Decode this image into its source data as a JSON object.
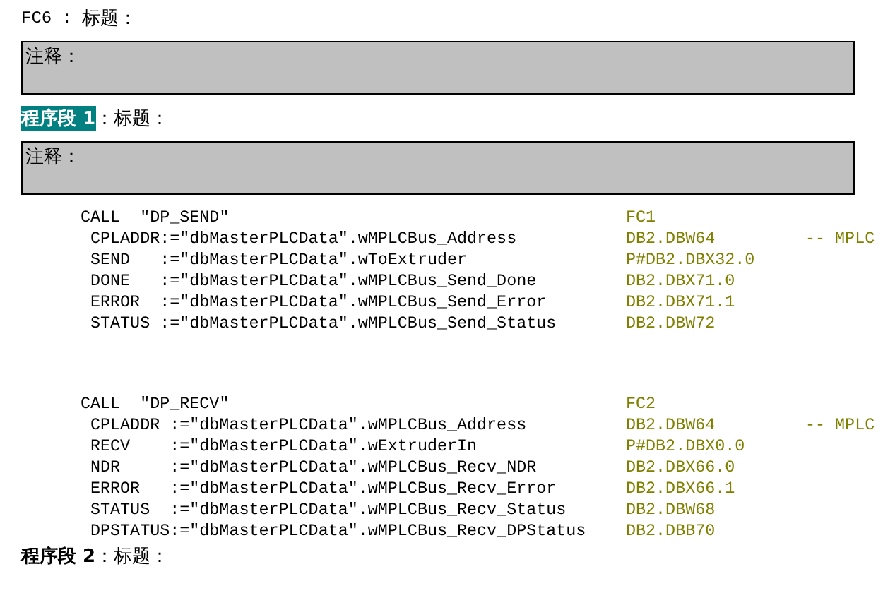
{
  "block_title": {
    "name": "FC6",
    "separator": " : ",
    "label": "标题：",
    "comment": "注释："
  },
  "networks": [
    {
      "label": "程序段 1",
      "selected": true,
      "title_label": "：标题：",
      "comment": "注释：",
      "calls": [
        {
          "statement": "CALL  \"DP_SEND\"",
          "block": "FC1",
          "params": [
            {
              "text": "CPLADDR:=\"dbMasterPLCData\".wMPLCBus_Address",
              "address": "DB2.DBW64",
              "comment": "-- MPLC"
            },
            {
              "text": "SEND   :=\"dbMasterPLCData\".wToExtruder",
              "address": "P#DB2.DBX32.0"
            },
            {
              "text": "DONE   :=\"dbMasterPLCData\".wMPLCBus_Send_Done",
              "address": "DB2.DBX71.0"
            },
            {
              "text": "ERROR  :=\"dbMasterPLCData\".wMPLCBus_Send_Error",
              "address": "DB2.DBX71.1"
            },
            {
              "text": "STATUS :=\"dbMasterPLCData\".wMPLCBus_Send_Status",
              "address": "DB2.DBW72"
            }
          ]
        },
        {
          "statement": "CALL  \"DP_RECV\"",
          "block": "FC2",
          "params": [
            {
              "text": "CPLADDR :=\"dbMasterPLCData\".wMPLCBus_Address",
              "address": "DB2.DBW64",
              "comment": "-- MPLC"
            },
            {
              "text": "RECV    :=\"dbMasterPLCData\".wExtruderIn",
              "address": "P#DB2.DBX0.0"
            },
            {
              "text": "NDR     :=\"dbMasterPLCData\".wMPLCBus_Recv_NDR",
              "address": "DB2.DBX66.0"
            },
            {
              "text": "ERROR   :=\"dbMasterPLCData\".wMPLCBus_Recv_Error",
              "address": "DB2.DBX66.1"
            },
            {
              "text": "STATUS  :=\"dbMasterPLCData\".wMPLCBus_Recv_Status",
              "address": "DB2.DBW68"
            },
            {
              "text": "DPSTATUS:=\"dbMasterPLCData\".wMPLCBus_Recv_DPStatus",
              "address": "DB2.DBB70"
            }
          ]
        }
      ]
    },
    {
      "label": "程序段 2",
      "selected": false,
      "title_label": "：标题："
    }
  ]
}
